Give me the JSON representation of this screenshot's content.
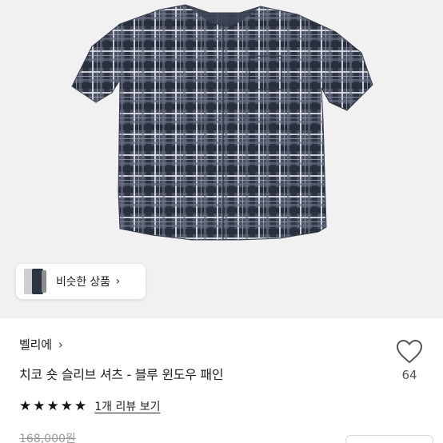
{
  "similar": {
    "label": "비슷한 상품",
    "chevron": "›"
  },
  "product": {
    "brand": "벨리에",
    "brand_chevron": "›",
    "title": "치코 숏 슬리브 셔츠 - 블루 윈도우 패인",
    "likes": "64",
    "rating_stars": 5,
    "review_link": "1개 리뷰 보기",
    "original_price": "168,000원"
  },
  "colors": {
    "hero_bg": "#f1f1f1",
    "shirt_base": "#4a5062",
    "check_dark": "#2a2f3d",
    "check_light": "#e4e6ec"
  },
  "icons": {
    "heart": "heart-icon",
    "star": "star-icon",
    "chevron": "chevron-right-icon"
  }
}
